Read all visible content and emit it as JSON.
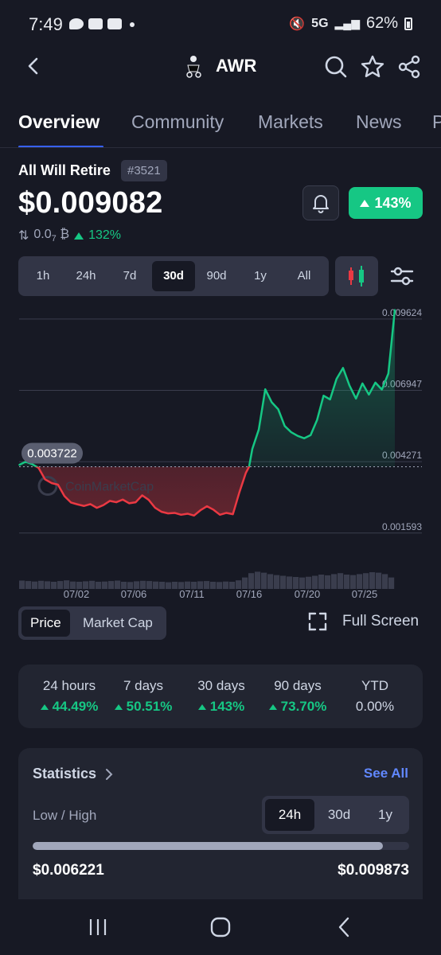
{
  "status_bar": {
    "time": "7:49",
    "network": "5G",
    "battery": "62%"
  },
  "header": {
    "symbol": "AWR"
  },
  "tabs": [
    {
      "label": "Overview",
      "active": true
    },
    {
      "label": "Community"
    },
    {
      "label": "Markets"
    },
    {
      "label": "News"
    },
    {
      "label": "P"
    }
  ],
  "coin": {
    "name": "All Will Retire",
    "rank": "#3521",
    "price": "$0.009082",
    "btc_price_prefix": "0.0",
    "btc_price_sub": "7",
    "btc_symbol": "₿",
    "btc_change": "132%",
    "change_30d": "143%"
  },
  "range": {
    "options": [
      "1h",
      "24h",
      "7d",
      "30d",
      "90d",
      "1y",
      "All"
    ],
    "selected": "30d"
  },
  "chart_data": {
    "type": "line",
    "y_ticks": [
      "0.009624",
      "0.006947",
      "0.004271",
      "0.001593"
    ],
    "ylim": [
      0.00063,
      0.00989
    ],
    "x_ticks": [
      "07/02",
      "07/06",
      "07/11",
      "07/16",
      "07/20",
      "07/25"
    ],
    "baseline": 0.003722,
    "baseline_label": "0.003722",
    "watermark": "CoinMarketCap",
    "series": [
      {
        "x": 0,
        "y": 0.00379
      },
      {
        "x": 1,
        "y": 0.00391
      },
      {
        "x": 2,
        "y": 0.00382
      },
      {
        "x": 3,
        "y": 0.00368
      },
      {
        "x": 4,
        "y": 0.00325
      },
      {
        "x": 5,
        "y": 0.00311
      },
      {
        "x": 6,
        "y": 0.00305
      },
      {
        "x": 7,
        "y": 0.00262
      },
      {
        "x": 8,
        "y": 0.00238
      },
      {
        "x": 9,
        "y": 0.00231
      },
      {
        "x": 10,
        "y": 0.00225
      },
      {
        "x": 11,
        "y": 0.00232
      },
      {
        "x": 12,
        "y": 0.00218
      },
      {
        "x": 13,
        "y": 0.00228
      },
      {
        "x": 14,
        "y": 0.00244
      },
      {
        "x": 15,
        "y": 0.00239
      },
      {
        "x": 16,
        "y": 0.00249
      },
      {
        "x": 17,
        "y": 0.00235
      },
      {
        "x": 18,
        "y": 0.00239
      },
      {
        "x": 19,
        "y": 0.00265
      },
      {
        "x": 20,
        "y": 0.00248
      },
      {
        "x": 21,
        "y": 0.00218
      },
      {
        "x": 22,
        "y": 0.00203
      },
      {
        "x": 23,
        "y": 0.00197
      },
      {
        "x": 24,
        "y": 0.00199
      },
      {
        "x": 25,
        "y": 0.00192
      },
      {
        "x": 26,
        "y": 0.00196
      },
      {
        "x": 27,
        "y": 0.00189
      },
      {
        "x": 28,
        "y": 0.00209
      },
      {
        "x": 29,
        "y": 0.00224
      },
      {
        "x": 30,
        "y": 0.00211
      },
      {
        "x": 31,
        "y": 0.00192
      },
      {
        "x": 32,
        "y": 0.00199
      },
      {
        "x": 33,
        "y": 0.00194
      },
      {
        "x": 34,
        "y": 0.00276
      },
      {
        "x": 35,
        "y": 0.00349
      },
      {
        "x": 35.5,
        "y": 0.00372
      },
      {
        "x": 36,
        "y": 0.00439
      },
      {
        "x": 37,
        "y": 0.00512
      },
      {
        "x": 38,
        "y": 0.00663
      },
      {
        "x": 39,
        "y": 0.00614
      },
      {
        "x": 40,
        "y": 0.00588
      },
      {
        "x": 41,
        "y": 0.00525
      },
      {
        "x": 42,
        "y": 0.00502
      },
      {
        "x": 43,
        "y": 0.00488
      },
      {
        "x": 44,
        "y": 0.00479
      },
      {
        "x": 45,
        "y": 0.00491
      },
      {
        "x": 46,
        "y": 0.00548
      },
      {
        "x": 47,
        "y": 0.00639
      },
      {
        "x": 48,
        "y": 0.00625
      },
      {
        "x": 49,
        "y": 0.00702
      },
      {
        "x": 50,
        "y": 0.00743
      },
      {
        "x": 51,
        "y": 0.00677
      },
      {
        "x": 52,
        "y": 0.00628
      },
      {
        "x": 53,
        "y": 0.00685
      },
      {
        "x": 54,
        "y": 0.00643
      },
      {
        "x": 55,
        "y": 0.00688
      },
      {
        "x": 56,
        "y": 0.00662
      },
      {
        "x": 57,
        "y": 0.00722
      },
      {
        "x": 58,
        "y": 0.00962
      }
    ],
    "volume": [
      0.35,
      0.33,
      0.31,
      0.34,
      0.32,
      0.3,
      0.33,
      0.36,
      0.31,
      0.3,
      0.32,
      0.34,
      0.3,
      0.31,
      0.33,
      0.35,
      0.3,
      0.29,
      0.32,
      0.34,
      0.33,
      0.31,
      0.3,
      0.28,
      0.3,
      0.29,
      0.31,
      0.3,
      0.32,
      0.33,
      0.3,
      0.29,
      0.31,
      0.3,
      0.36,
      0.48,
      0.66,
      0.72,
      0.68,
      0.62,
      0.58,
      0.55,
      0.52,
      0.5,
      0.48,
      0.51,
      0.55,
      0.6,
      0.57,
      0.62,
      0.66,
      0.6,
      0.58,
      0.62,
      0.66,
      0.7,
      0.68,
      0.62,
      0.48
    ],
    "colors": {
      "up": "#16c784",
      "down": "#ea3943",
      "grid": "#3a3d4d"
    }
  },
  "chart_toggle": {
    "price": "Price",
    "market_cap": "Market Cap",
    "selected": "Price"
  },
  "fullscreen_label": "Full Screen",
  "performance": [
    {
      "label": "24 hours",
      "value": "44.49%",
      "trend": "up"
    },
    {
      "label": "7 days",
      "value": "50.51%",
      "trend": "up"
    },
    {
      "label": "30 days",
      "value": "143%",
      "trend": "up"
    },
    {
      "label": "90 days",
      "value": "73.70%",
      "trend": "up"
    },
    {
      "label": "YTD",
      "value": "0.00%",
      "trend": "flat"
    }
  ],
  "statistics": {
    "title": "Statistics",
    "see_all": "See All",
    "range_label": "Low / High",
    "periods": [
      "24h",
      "30d",
      "1y"
    ],
    "selected_period": "24h",
    "low": "$0.006221",
    "high": "$0.009873",
    "position": 0.93
  },
  "colors": {
    "accent": "#3861fb",
    "positive": "#16c784",
    "negative": "#ea3943",
    "background": "#171924",
    "card": "#222531"
  }
}
